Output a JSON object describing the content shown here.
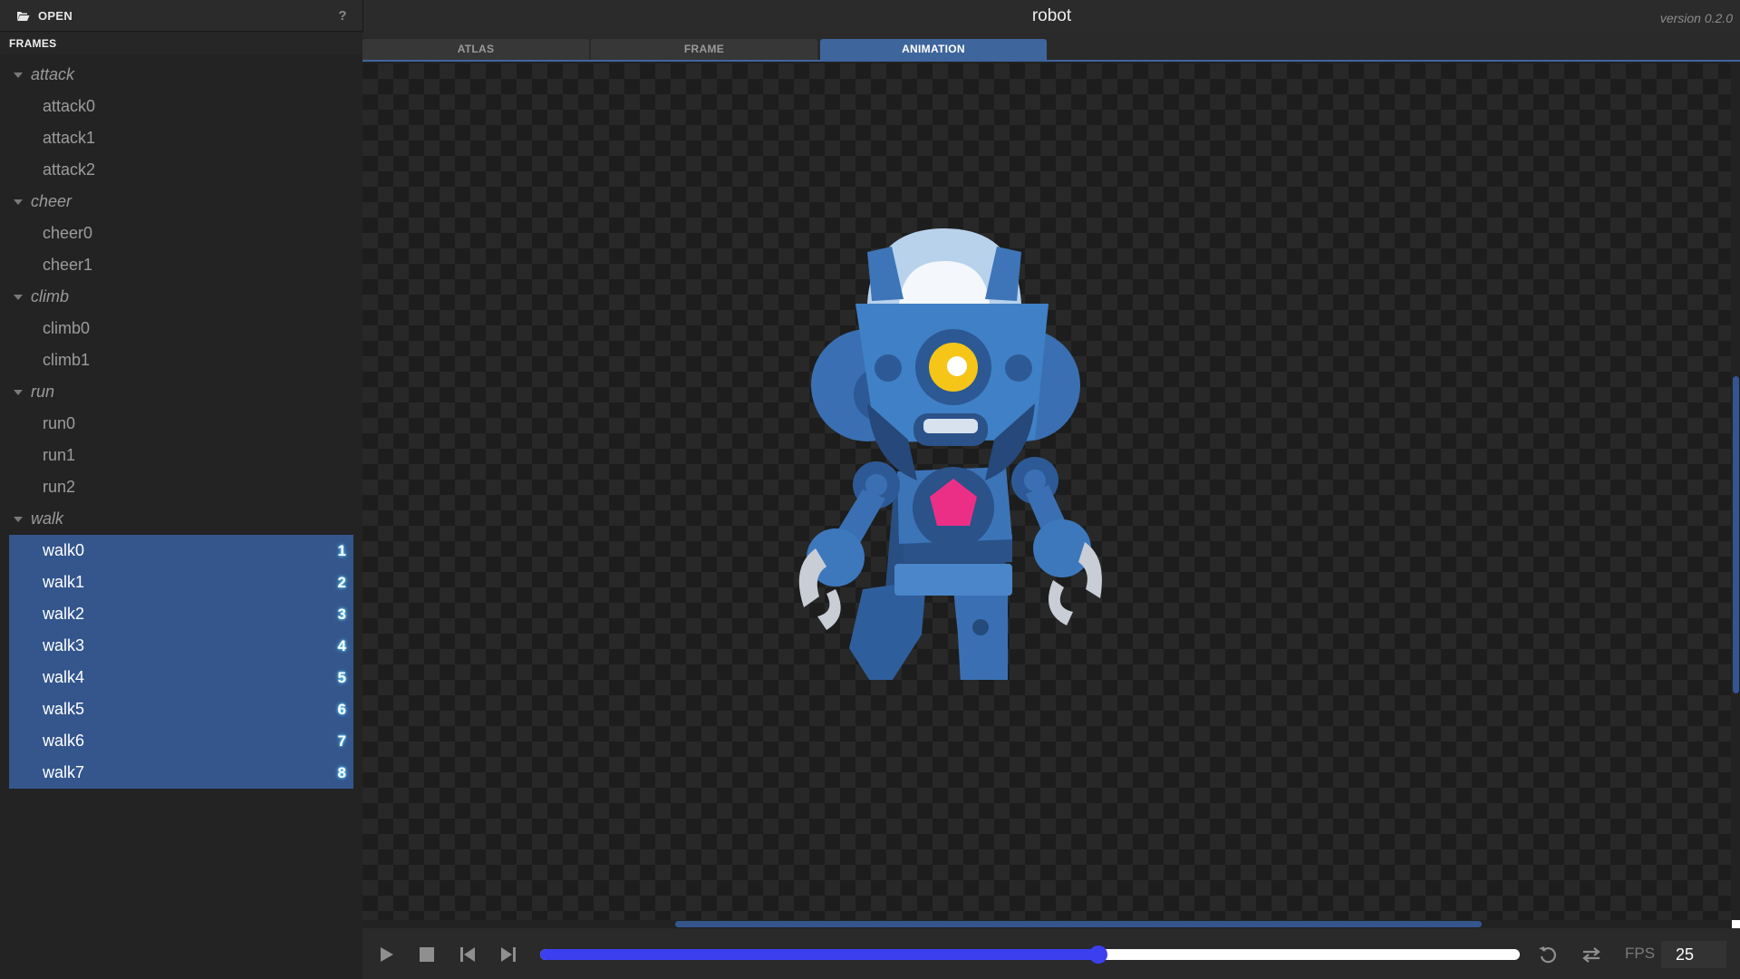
{
  "toolbar": {
    "open_label": "OPEN",
    "help_label": "?"
  },
  "frames_panel": {
    "header": "FRAMES",
    "groups": [
      {
        "name": "attack",
        "frames": [
          {
            "label": "attack0"
          },
          {
            "label": "attack1"
          },
          {
            "label": "attack2"
          }
        ]
      },
      {
        "name": "cheer",
        "frames": [
          {
            "label": "cheer0"
          },
          {
            "label": "cheer1"
          }
        ]
      },
      {
        "name": "climb",
        "frames": [
          {
            "label": "climb0"
          },
          {
            "label": "climb1"
          }
        ]
      },
      {
        "name": "run",
        "frames": [
          {
            "label": "run0"
          },
          {
            "label": "run1"
          },
          {
            "label": "run2"
          }
        ]
      },
      {
        "name": "walk",
        "frames": [
          {
            "label": "walk0",
            "index": "1",
            "selected": true
          },
          {
            "label": "walk1",
            "index": "2",
            "selected": true
          },
          {
            "label": "walk2",
            "index": "3",
            "selected": true
          },
          {
            "label": "walk3",
            "index": "4",
            "selected": true
          },
          {
            "label": "walk4",
            "index": "5",
            "selected": true
          },
          {
            "label": "walk5",
            "index": "6",
            "selected": true
          },
          {
            "label": "walk6",
            "index": "7",
            "selected": true
          },
          {
            "label": "walk7",
            "index": "8",
            "selected": true
          }
        ]
      }
    ]
  },
  "header": {
    "title": "robot",
    "version": "version 0.2.0"
  },
  "tabs": [
    {
      "label": "ATLAS",
      "active": false
    },
    {
      "label": "FRAME",
      "active": false
    },
    {
      "label": "ANIMATION",
      "active": true
    }
  ],
  "player": {
    "progress": 0.57,
    "fps_label": "FPS",
    "fps_value": "25",
    "buttons": [
      "play-icon",
      "stop-icon",
      "skip-back-icon",
      "skip-forward-icon",
      "reset-icon",
      "loop-icon"
    ]
  },
  "colors": {
    "accent": "#3f659d",
    "selection": "#34568d",
    "timeline_fill": "#3c3ff0",
    "index_glow": "#5fd3ff"
  }
}
